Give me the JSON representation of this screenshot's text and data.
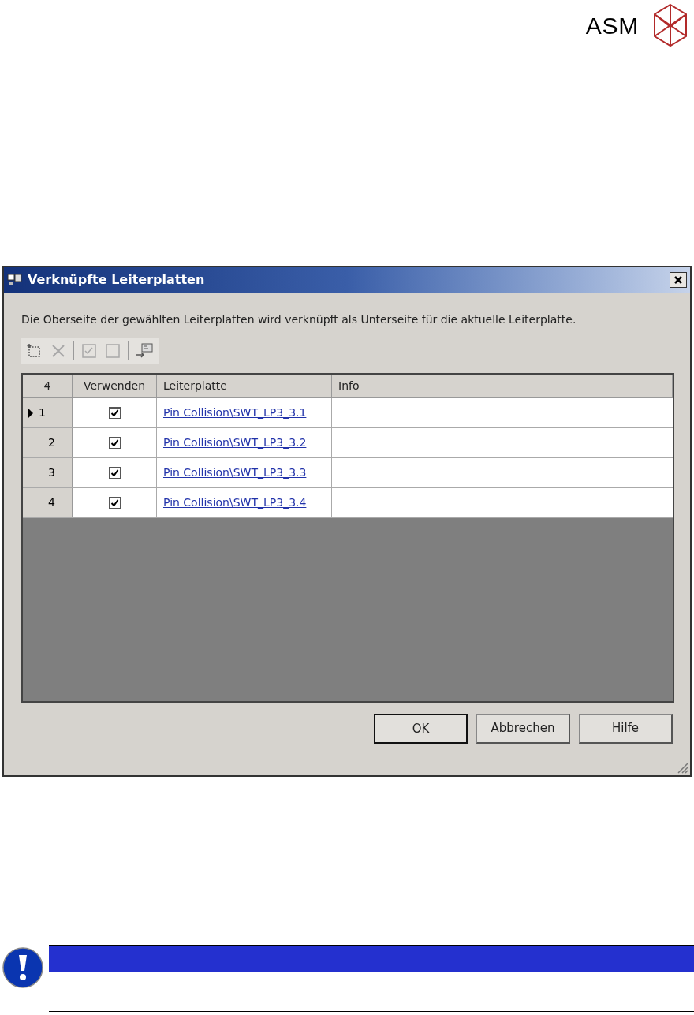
{
  "header": {
    "logo_text": "ASM"
  },
  "dialog": {
    "title": "Verknüpfte Leiterplatten",
    "description": "Die Oberseite der gewählten Leiterplatten wird verknüpft als Unterseite für die aktuelle Leiterplatte.",
    "toolbar": [
      {
        "kind": "new",
        "disabled": false
      },
      {
        "kind": "delete",
        "disabled": true
      },
      {
        "kind": "separator"
      },
      {
        "kind": "check-all",
        "disabled": true
      },
      {
        "kind": "uncheck-all",
        "disabled": true
      },
      {
        "kind": "separator"
      },
      {
        "kind": "link",
        "disabled": false
      }
    ],
    "table": {
      "row_count": "4",
      "columns": [
        "Verwenden",
        "Leiterplatte",
        "Info"
      ],
      "rows": [
        {
          "number": "1",
          "current": true,
          "checked": true,
          "board": "Pin Collision\\SWT_LP3_3.1"
        },
        {
          "number": "2",
          "current": false,
          "checked": true,
          "board": "Pin Collision\\SWT_LP3_3.2"
        },
        {
          "number": "3",
          "current": false,
          "checked": true,
          "board": "Pin Collision\\SWT_LP3_3.3"
        },
        {
          "number": "4",
          "current": false,
          "checked": true,
          "board": "Pin Collision\\SWT_LP3_3.4"
        }
      ]
    },
    "buttons": [
      {
        "label": "OK",
        "default": true
      },
      {
        "label": "Abbrechen",
        "default": false
      },
      {
        "label": "Hilfe",
        "default": false
      }
    ]
  }
}
